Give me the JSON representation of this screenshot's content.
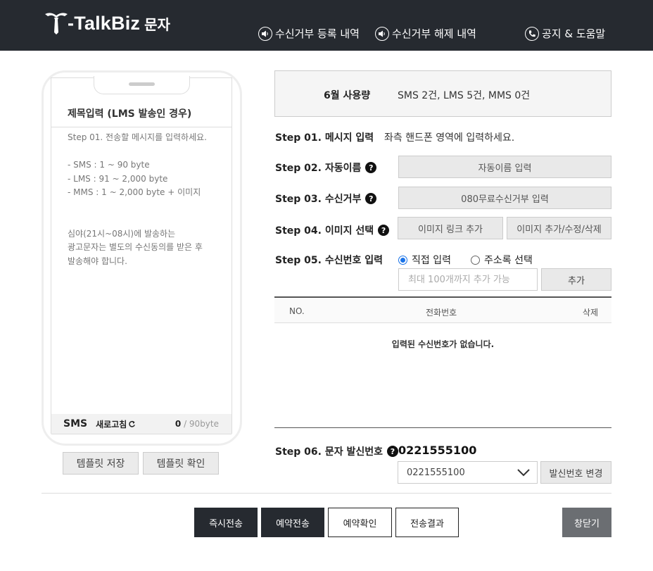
{
  "header": {
    "brand": "-TalkBiz",
    "brand_suffix": "문자",
    "nav": [
      {
        "label": "수신거부 등록 내역",
        "icon": "speaker-icon"
      },
      {
        "label": "수신거부 해제 내역",
        "icon": "speaker-icon"
      },
      {
        "label": "공지 & 도움말",
        "icon": "phone-icon"
      }
    ]
  },
  "phone": {
    "subject_placeholder": "제목입력 (LMS 발송인 경우)",
    "guide": {
      "line1": "Step 01. 전송할 메시지를 입력하세요.",
      "sms": "- SMS : 1 ~ 90 byte",
      "lms": "- LMS : 91 ~ 2,000 byte",
      "mms": "- MMS : 1 ~ 2,000 byte + 이미지",
      "night1": "심야(21시~08시)에 발송하는",
      "night2": "광고문자는 별도의 수신동의를 받은 후",
      "night3": "발송해야 합니다."
    },
    "footer": {
      "type": "SMS",
      "refresh": "새로고침",
      "bytes_used": "0",
      "bytes_max": " / 90byte"
    }
  },
  "template_buttons": {
    "save": "템플릿 저장",
    "confirm": "템플릿 확인"
  },
  "usage": {
    "label": "6월 사용량",
    "values": "SMS 2건,  LMS 5건,  MMS 0건"
  },
  "steps": {
    "s1": {
      "label": "Step 01. 메시지 입력",
      "desc": "좌측 핸드폰 영역에 입력하세요."
    },
    "s2": {
      "label": "Step 02. 자동이름",
      "button": "자동이름 입력"
    },
    "s3": {
      "label": "Step 03. 수신거부",
      "button": "080무료수신거부 입력"
    },
    "s4": {
      "label": "Step 04. 이미지 선택",
      "button1": "이미지 링크 추가",
      "button2": "이미지 추가/수정/삭제"
    },
    "s5": {
      "label": "Step 05. 수신번호 입력",
      "radio_direct": "직접 입력",
      "radio_address": "주소록 선택",
      "placeholder": "최대 100개까지 추가 가능",
      "add_button": "추가"
    },
    "s6": {
      "label": "Step 06. 문자 발신번호",
      "number": "0221555100",
      "selected": "0221555100",
      "change_button": "발신번호 변경"
    }
  },
  "table": {
    "col_no": "NO.",
    "col_phone": "전화번호",
    "col_delete": "삭제",
    "empty": "입력된 수신번호가 없습니다."
  },
  "actions": {
    "send_now": "즉시전송",
    "reserve": "예약전송",
    "reserve_check": "예약확인",
    "result": "전송결과",
    "close": "창닫기"
  }
}
